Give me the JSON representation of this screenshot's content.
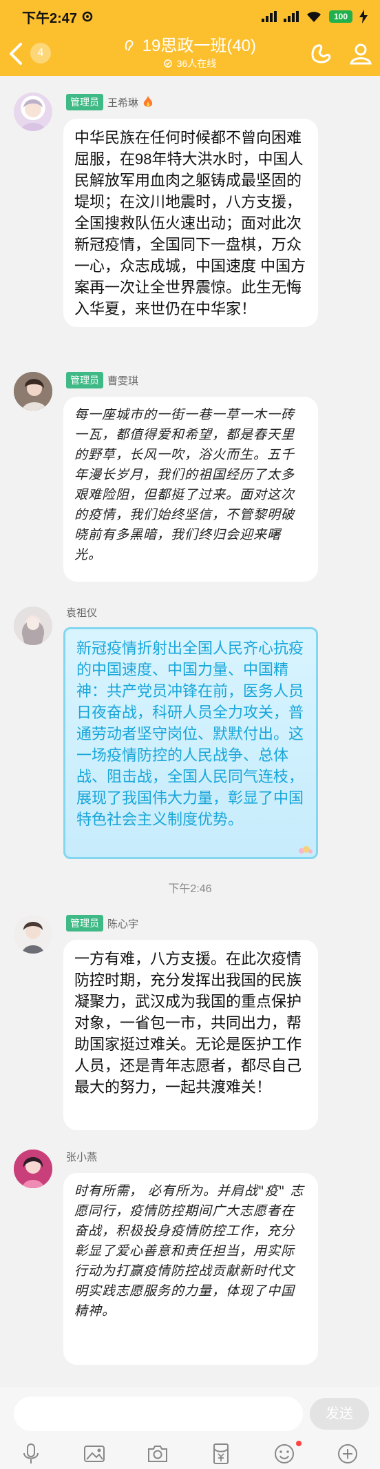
{
  "statusbar": {
    "time": "下午2:47",
    "battery": "100"
  },
  "header": {
    "unread_count": "4",
    "title": "19思政一班(40)",
    "online_text": "36人在线"
  },
  "messages": [
    {
      "name": "王希琳",
      "badge": "管理员",
      "text": "中华民族在任何时候都不曾向困难屈服，在98年特大洪水时，中国人民解放军用血肉之躯铸成最坚固的堤坝；在汶川地震时，八方支援，全国搜救队伍火速出动；面对此次新冠疫情，全国同下一盘棋，万众一心，众志成城，中国速度 中国方案再一次让全世界震惊。此生无悔入华夏，来世仍在中华家！"
    },
    {
      "name": "曹雯琪",
      "badge": "管理员",
      "text": "每一座城市的一街一巷一草一木一砖一瓦，都值得爱和希望，都是春天里的野草，长风一吹，浴火而生。五千年漫长岁月，我们的祖国经历了太多艰难险阻，但都挺了过来。面对这次的疫情，我们始终坚信，不管黎明破晓前有多黑暗，我们终归会迎来曙光。"
    },
    {
      "name": "袁祖仪",
      "badge": "",
      "text": "新冠疫情折射出全国人民齐心抗疫的中国速度、中国力量、中国精神：共产党员冲锋在前，医务人员日夜奋战，科研人员全力攻关，普通劳动者坚守岗位、默默付出。这一场疫情防控的人民战争、总体战、阻击战，全国人民同气连枝，展现了我国伟大力量，彰显了中国特色社会主义制度优势。"
    },
    {
      "name": "陈心宇",
      "badge": "管理员",
      "text": "一方有难，八方支援。在此次疫情防控时期，充分发挥出我国的民族凝聚力，武汉成为我国的重点保护对象，一省包一市，共同出力，帮助国家挺过难关。无论是医护工作人员，还是青年志愿者，都尽自己最大的努力，一起共渡难关！"
    },
    {
      "name": "张小燕",
      "badge": "",
      "text": "时有所需， 必有所为。并肩战\"疫\" 志愿同行，疫情防控期间广大志愿者在奋战，积极投身疫情防控工作，充分彰显了爱心善意和责任担当，用实际行动为打赢疫情防控战贡献新时代文明实践志愿服务的力量，体现了中国精神。"
    }
  ],
  "time_separator": "下午2:46",
  "input": {
    "placeholder": "",
    "send_label": "发送"
  },
  "colors": {
    "header": "#fcc02f",
    "admin_badge": "#3fb985",
    "blue_text": "#18a6d9"
  },
  "toolbar_icons": [
    "microphone-icon",
    "image-icon",
    "camera-icon",
    "red-packet-icon",
    "emoji-icon",
    "plus-icon"
  ]
}
